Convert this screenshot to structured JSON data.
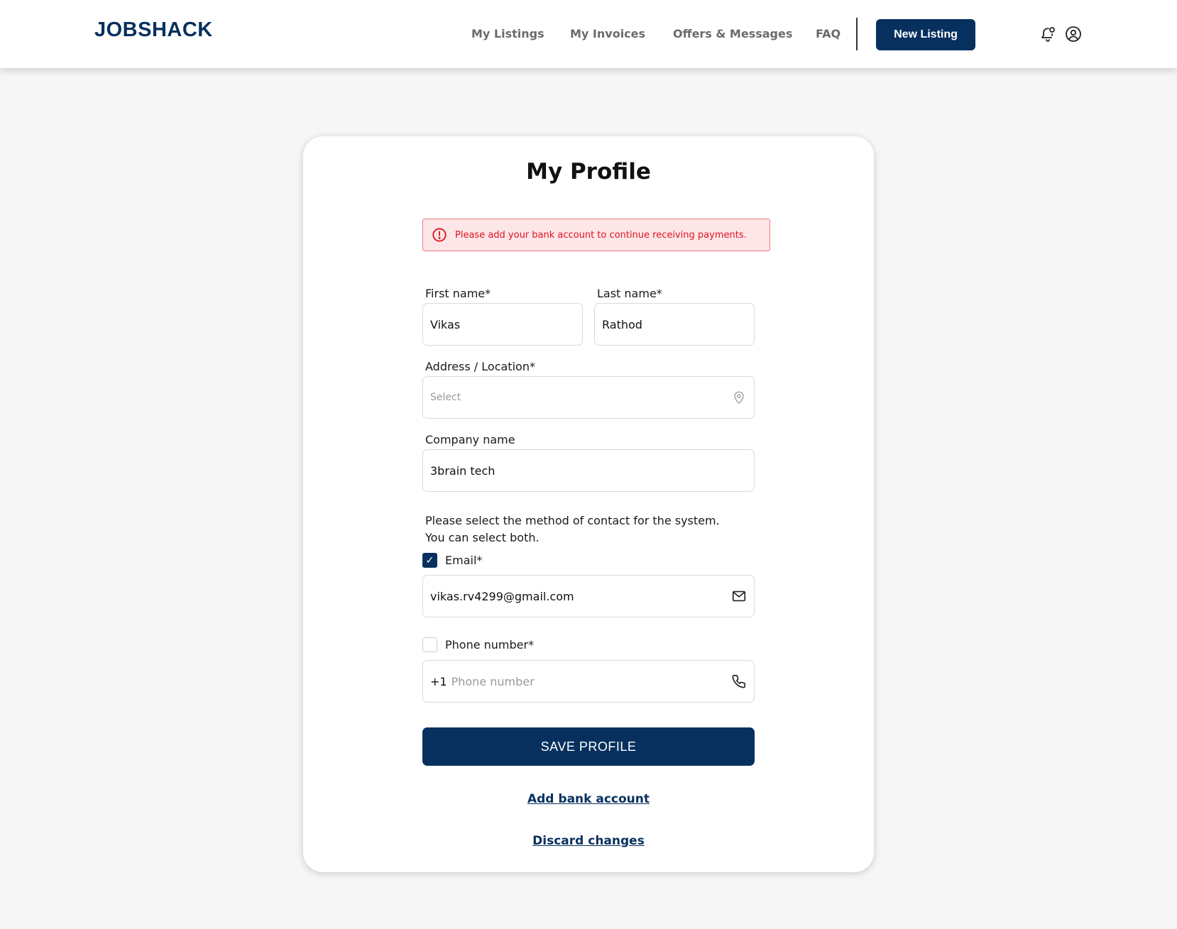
{
  "header": {
    "logo": "JOBSHACK",
    "nav": [
      {
        "label": "My Listings"
      },
      {
        "label": "My Invoices"
      },
      {
        "label": "Offers & Messages"
      },
      {
        "label": "FAQ"
      }
    ],
    "new_listing_label": "New Listing",
    "icons": [
      "notification-bell-icon",
      "user-account-icon"
    ]
  },
  "profile": {
    "title": "My Profile",
    "alert": {
      "icon": "alert-circle-icon",
      "text": "Please add your bank account to continue receiving payments."
    },
    "first_name": {
      "label": "First name*",
      "value": "Vikas"
    },
    "last_name": {
      "label": "Last name*",
      "value": "Rathod"
    },
    "address": {
      "label": "Address / Location*",
      "placeholder": "Select",
      "icon": "location-pin-icon"
    },
    "company": {
      "label": "Company name",
      "value": "3brain tech"
    },
    "contact_info_line1": "Please select the method of contact for the system.",
    "contact_info_line2": "You can select both.",
    "email": {
      "label": "Email*",
      "checked": true,
      "value": "vikas.rv4299@gmail.com",
      "icon": "mail-icon"
    },
    "phone": {
      "label": "Phone number*",
      "checked": false,
      "prefix": "+1",
      "placeholder": "Phone number",
      "icon": "phone-icon"
    },
    "save_label": "SAVE PROFILE",
    "add_bank_label": "Add bank account",
    "discard_label": "Discard changes"
  },
  "colors": {
    "brand": "#07305f",
    "alert_text": "#e0121f",
    "alert_bg": "#fde6e7",
    "page_bg": "#f6f6f6"
  }
}
